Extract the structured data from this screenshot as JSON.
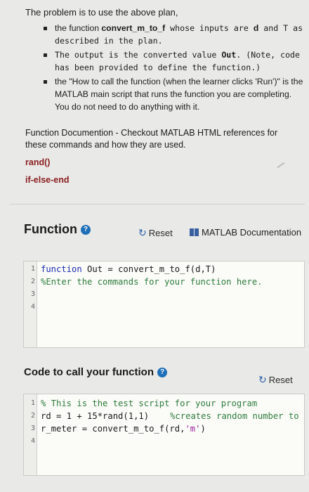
{
  "intro": "The problem is to use the above plan,",
  "bullets": [
    {
      "pre": "the function ",
      "bold": "convert_m_to_f",
      "mono": " whose inputs are ",
      "bold2": "d",
      "mono2": " and T as described in the plan."
    },
    {
      "mono": "The output is the converted value ",
      "bold": "Out",
      "mono2": ". (Note, code has been provided to define the function.)"
    },
    {
      "text": "the \"How to call the function (when the learner clicks 'Run')\" is the MATLAB main script that runs the function you are completing. You do not need to do anything with it."
    }
  ],
  "doc_title": "Function Documention - Checkout MATLAB HTML references for these commands and how they are used.",
  "refs": [
    "rand()",
    "if-else-end"
  ],
  "function_section": {
    "title": "Function",
    "info_icon": "question-circle-icon",
    "reset_label": "Reset",
    "doc_link_label": "MATLAB Documentation",
    "lines": [
      {
        "n": "1",
        "kw": "function",
        "rest": " Out = convert_m_to_f(d,T)"
      },
      {
        "n": "2",
        "comment": "%Enter the commands for your function here."
      },
      {
        "n": "3",
        "text": ""
      },
      {
        "n": "4",
        "text": ""
      }
    ]
  },
  "call_section": {
    "title": "Code to call your function",
    "info_icon": "question-circle-icon",
    "reset_label": "Reset",
    "lines": [
      {
        "n": "1",
        "comment": "% This is the test script for your program"
      },
      {
        "n": "2",
        "code": "rd = 1 + 15*rand(1,1)",
        "comment": "%creates random number to"
      },
      {
        "n": "3",
        "code": "r_meter = convert_m_to_f(rd,",
        "string": "'m'",
        "tail": ")"
      },
      {
        "n": "4",
        "text": ""
      }
    ]
  },
  "colors": {
    "accent": "#1e6fb8",
    "keyword": "#1d2fb5",
    "comment": "#2f7d3d",
    "string": "#a0219f",
    "ref": "#8b1e20"
  }
}
